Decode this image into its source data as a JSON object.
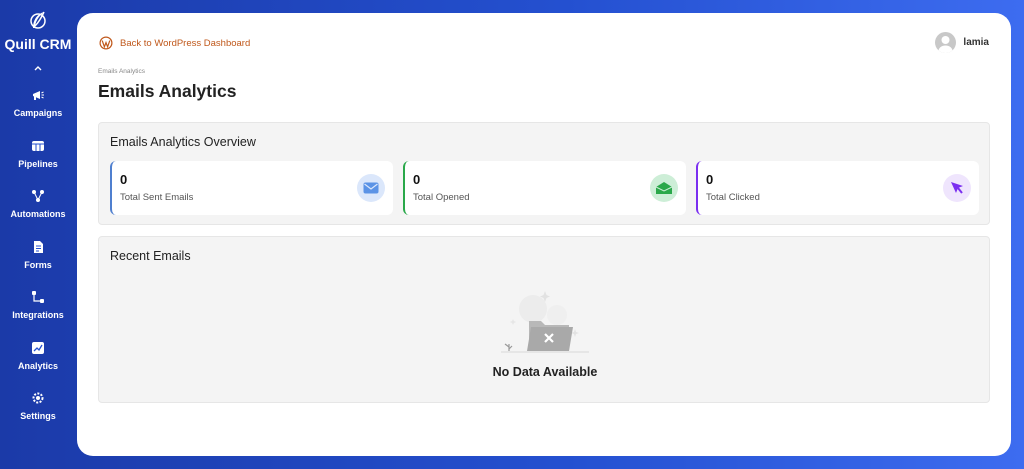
{
  "brand": {
    "name": "Quill CRM"
  },
  "sidebar": {
    "items": [
      {
        "label": "Campaigns",
        "icon": "megaphone-icon"
      },
      {
        "label": "Pipelines",
        "icon": "pipeline-icon"
      },
      {
        "label": "Automations",
        "icon": "automation-icon"
      },
      {
        "label": "Forms",
        "icon": "form-icon"
      },
      {
        "label": "Integrations",
        "icon": "integration-icon"
      },
      {
        "label": "Analytics",
        "icon": "analytics-icon"
      },
      {
        "label": "Settings",
        "icon": "gear-icon"
      }
    ]
  },
  "header": {
    "back_label": "Back to WordPress Dashboard",
    "user_name": "lamia"
  },
  "page": {
    "breadcrumb": "Emails Analytics",
    "title": "Emails Analytics"
  },
  "overview": {
    "title": "Emails Analytics Overview",
    "stats": [
      {
        "value": "0",
        "label": "Total Sent Emails",
        "color": "#4f7fcf",
        "icon": "envelope-icon"
      },
      {
        "value": "0",
        "label": "Total Opened",
        "color": "#2aa84a",
        "icon": "open-envelope-icon"
      },
      {
        "value": "0",
        "label": "Total Clicked",
        "color": "#7b2ff0",
        "icon": "cursor-icon"
      }
    ]
  },
  "recent": {
    "title": "Recent Emails",
    "empty_text": "No Data Available"
  },
  "colors": {
    "sidebar_bg": "#1b3aa8",
    "accent_link": "#c0581b"
  }
}
